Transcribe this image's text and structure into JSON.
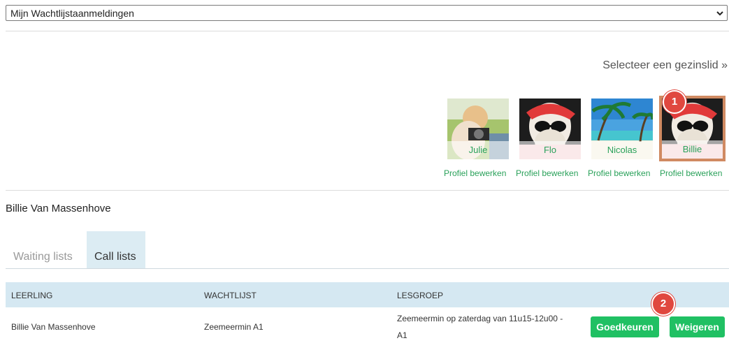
{
  "dropdown": {
    "selected": "Mijn Wachtlijstaanmeldingen"
  },
  "family": {
    "prompt": "Selecteer een gezinslid »",
    "members": [
      {
        "name": "Julie",
        "edit": "Profiel bewerken"
      },
      {
        "name": "Flo",
        "edit": "Profiel bewerken"
      },
      {
        "name": "Nicolas",
        "edit": "Profiel bewerken"
      },
      {
        "name": "Billie",
        "edit": "Profiel bewerken",
        "selected": true
      }
    ]
  },
  "badges": [
    "1",
    "2"
  ],
  "person": {
    "name": "Billie Van Massenhove"
  },
  "tabs": [
    {
      "label": "Waiting lists",
      "active": false
    },
    {
      "label": "Call lists",
      "active": true
    }
  ],
  "table": {
    "headers": [
      "LEERLING",
      "WACHTLIJST",
      "LESGROEP"
    ],
    "rows": [
      {
        "leerling": "Billie Van Massenhove",
        "wachtlijst": "Zeemeermin A1",
        "lesgroep_line1": "Zeemeermin op zaterdag van 11u15-12u00 -",
        "lesgroep_line2": "A1"
      }
    ],
    "approve_label": "Goedkeuren",
    "reject_label": "Weigeren"
  },
  "colors": {
    "accent_green": "#20c063",
    "link_green": "#2aa15a",
    "badge_red": "#e0483f",
    "header_bg": "#d5e8f2",
    "selected_border": "#d08a62"
  }
}
